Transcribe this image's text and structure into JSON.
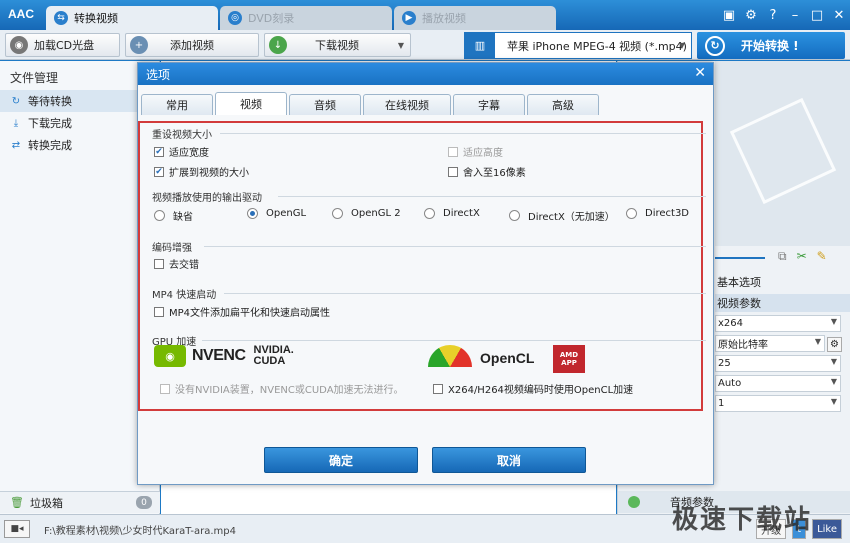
{
  "app": {
    "logo": "AAC"
  },
  "main_tabs": [
    {
      "label": "转换视频",
      "icon": "convert-icon"
    },
    {
      "label": "DVD刻录",
      "icon": "disc-icon"
    },
    {
      "label": "播放视频",
      "icon": "play-icon"
    }
  ],
  "window_controls": {
    "minimize": "–",
    "maximize": "□",
    "close": "✕",
    "help": "?"
  },
  "toolbar": {
    "load_cd": "加载CD光盘",
    "add_video": "添加视频",
    "download_video": "下载视频",
    "profile": "苹果 iPhone MPEG-4 视频 (*.mp4)",
    "start": "开始转换 !"
  },
  "left_panel": {
    "title": "文件管理",
    "items": [
      {
        "label": "等待转换"
      },
      {
        "label": "下载完成"
      },
      {
        "label": "转换完成"
      }
    ],
    "trash": "垃圾箱",
    "trash_count": "0"
  },
  "right_panel": {
    "basic_options": "基本选项",
    "video_params": "视频参数",
    "codec": "x264",
    "bitrate": "原始比特率",
    "fps": "25",
    "aspect": "Auto",
    "passes": "1",
    "audio_params": "音频参数"
  },
  "statusbar": {
    "path": "F:\\教程素材\\视频\\少女时代KaraT-ara.mp4",
    "upgrade": "升级",
    "like": "Like"
  },
  "watermark": "极速下载站",
  "dialog": {
    "title": "选项",
    "close": "✕",
    "tabs": [
      "常用",
      "视频",
      "音频",
      "在线视频",
      "字幕",
      "高级"
    ],
    "active_tab": "视频",
    "size_group": "重设视频大小",
    "fit_width": "适应宽度",
    "fit_height": "适应高度",
    "expand": "扩展到视频的大小",
    "round16": "舍入至16像素",
    "driver_group": "视频播放使用的输出驱动",
    "drivers": [
      "缺省",
      "OpenGL",
      "OpenGL 2",
      "DirectX",
      "DirectX（无加速）",
      "Direct3D"
    ],
    "selected_driver": "OpenGL",
    "enc_group": "编码增强",
    "deinterlace": "去交错",
    "mp4_group": "MP4 快速启动",
    "mp4_option": "MP4文件添加扁平化和快速启动属性",
    "gpu_group": "GPU 加速",
    "nvenc": "NVENC",
    "nvidia": "NVIDIA.",
    "cuda": "CUDA",
    "opencl": "OpenCL",
    "amd": "AMD APP",
    "nvidia_note": "没有NVIDIA装置，NVENC或CUDA加速无法进行。",
    "opencl_option": "X264/H264视频编码时使用OpenCL加速",
    "ok": "确定",
    "cancel": "取消"
  }
}
